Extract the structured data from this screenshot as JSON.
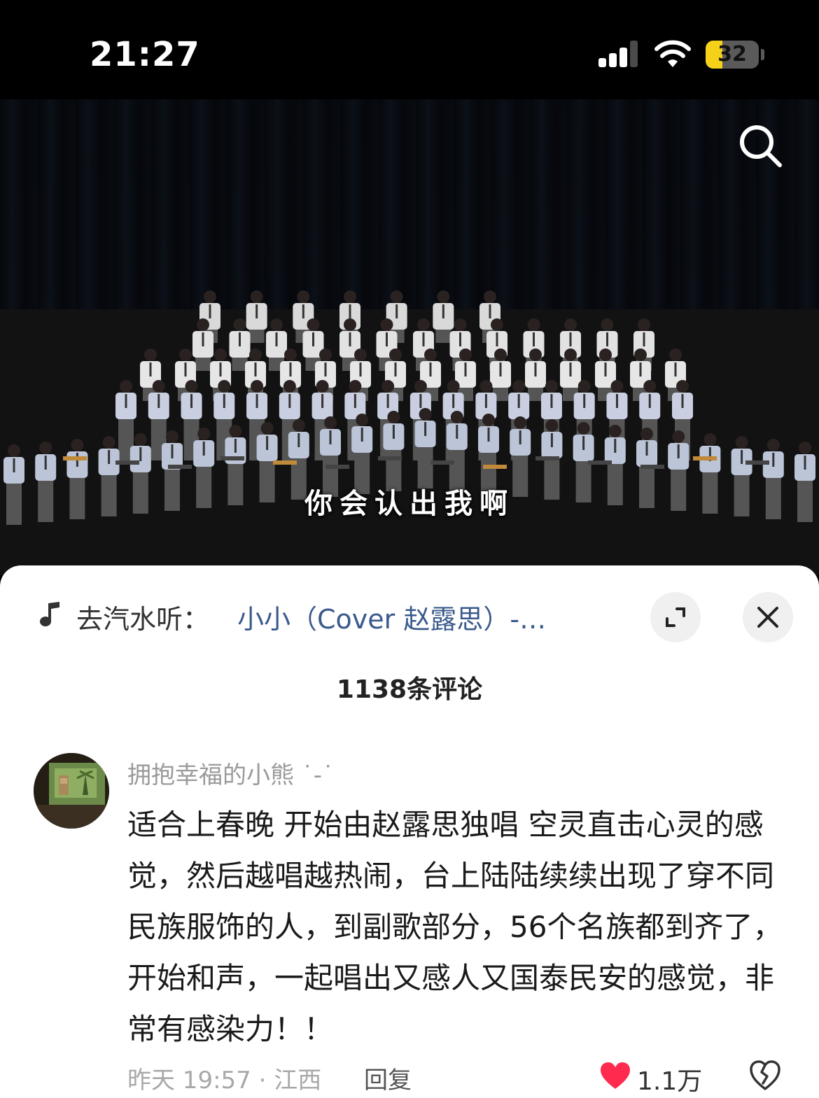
{
  "status_bar": {
    "time": "21:27",
    "battery_level": "32",
    "battery_color": "#f5d11a",
    "icons": [
      "signal-icon",
      "wifi-icon",
      "battery-icon"
    ]
  },
  "video": {
    "subtitle": "你会认出我啊",
    "icons": [
      "search-icon"
    ]
  },
  "sheet": {
    "music_prefix": "去汽水听：",
    "music_title": "小小（Cover 赵露思）-…",
    "music_title_color": "#3a5a8c",
    "comment_count": "1138条评论",
    "icons": [
      "music-note-icon",
      "expand-icon",
      "close-icon"
    ]
  },
  "comment": {
    "username": "拥抱幸福的小熊 ˙-˙",
    "text": "适合上春晚 开始由赵露思独唱 空灵直击心灵的感觉，然后越唱越热闹，台上陆陆续续出现了穿不同民族服饰的人，到副歌部分，56个名族都到齐了，开始和声，一起唱出又感人又国泰民安的感觉，非常有感染力！！",
    "time_location": "昨天 19:57 · 江西",
    "reply_label": "回复",
    "like_count": "1.1万",
    "liked": true,
    "heart_color": "#ff2b4f",
    "icons": [
      "avatar",
      "heart-icon",
      "dislike-icon"
    ]
  }
}
